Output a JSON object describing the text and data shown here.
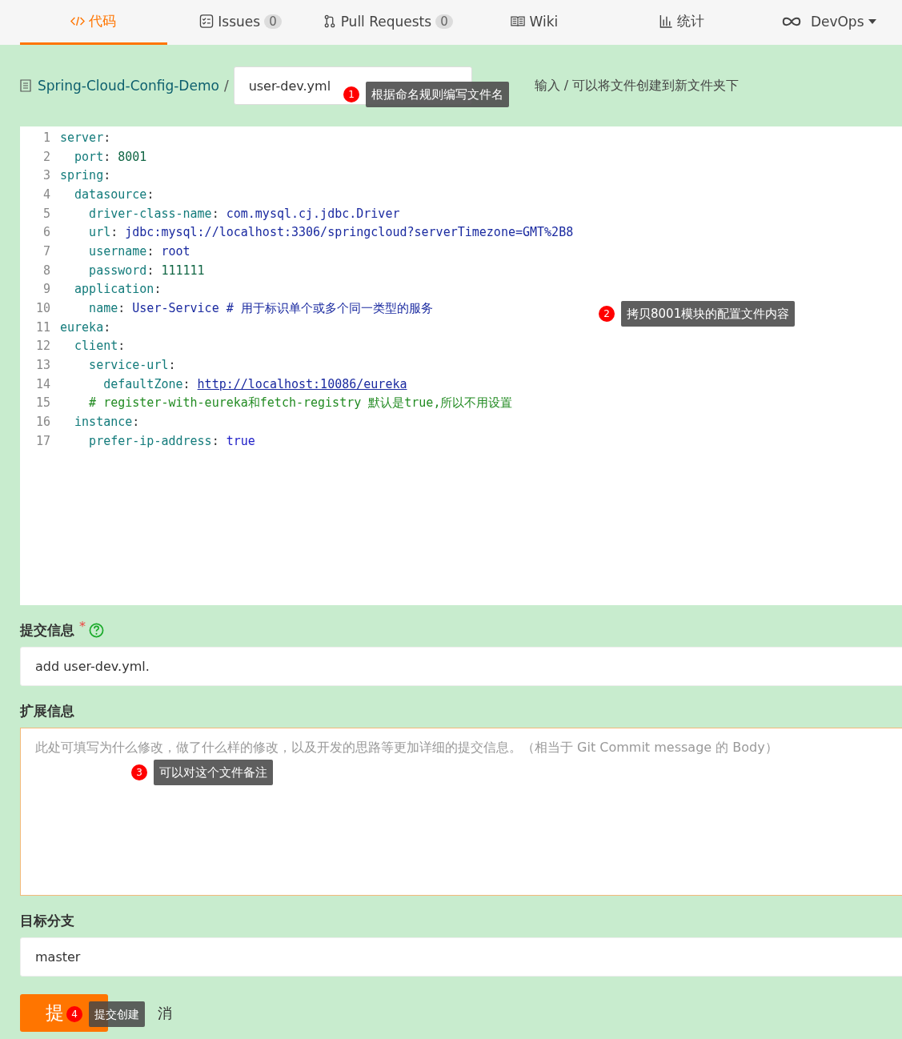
{
  "tabs": [
    {
      "label": "代码",
      "selected": true
    },
    {
      "label": "Issues",
      "count": "0",
      "selected": false
    },
    {
      "label": "Pull Requests",
      "count": "0",
      "selected": false
    },
    {
      "label": "Wiki",
      "selected": false
    },
    {
      "label": "统计",
      "selected": false
    },
    {
      "label": "DevOps",
      "selected": false
    }
  ],
  "breadcrumb": {
    "repo": "Spring-Cloud-Config-Demo",
    "separator": "/",
    "filename": "user-dev.yml",
    "hint": "输入 / 可以将文件创建到新文件夹下"
  },
  "editor": {
    "lines": [
      {
        "number": "1",
        "segments": [
          {
            "kind": "key",
            "text": "server"
          },
          {
            "kind": "punct",
            "text": ":"
          }
        ]
      },
      {
        "number": "2",
        "segments": [
          {
            "kind": "key",
            "text": "  port"
          },
          {
            "kind": "punct",
            "text": ": "
          },
          {
            "kind": "number",
            "text": "8001"
          }
        ]
      },
      {
        "number": "3",
        "segments": [
          {
            "kind": "key",
            "text": "spring"
          },
          {
            "kind": "punct",
            "text": ":"
          }
        ]
      },
      {
        "number": "4",
        "segments": [
          {
            "kind": "key",
            "text": "  datasource"
          },
          {
            "kind": "punct",
            "text": ":"
          }
        ]
      },
      {
        "number": "5",
        "segments": [
          {
            "kind": "key",
            "text": "    driver-class-name"
          },
          {
            "kind": "punct",
            "text": ": "
          },
          {
            "kind": "string",
            "text": "com.mysql.cj.jdbc.Driver"
          }
        ]
      },
      {
        "number": "6",
        "segments": [
          {
            "kind": "key",
            "text": "    url"
          },
          {
            "kind": "punct",
            "text": ": "
          },
          {
            "kind": "string",
            "text": "jdbc:mysql://localhost:3306/springcloud?serverTimezone=GMT%2B8"
          }
        ]
      },
      {
        "number": "7",
        "segments": [
          {
            "kind": "key",
            "text": "    username"
          },
          {
            "kind": "punct",
            "text": ": "
          },
          {
            "kind": "string",
            "text": "root"
          }
        ]
      },
      {
        "number": "8",
        "segments": [
          {
            "kind": "key",
            "text": "    password"
          },
          {
            "kind": "punct",
            "text": ": "
          },
          {
            "kind": "number",
            "text": "111111"
          }
        ]
      },
      {
        "number": "9",
        "segments": [
          {
            "kind": "key",
            "text": "  application"
          },
          {
            "kind": "punct",
            "text": ":"
          }
        ]
      },
      {
        "number": "10",
        "segments": [
          {
            "kind": "key",
            "text": "    name"
          },
          {
            "kind": "punct",
            "text": ": "
          },
          {
            "kind": "string",
            "text": "User-Service # 用于标识单个或多个同一类型的服务"
          }
        ]
      },
      {
        "number": "11",
        "segments": [
          {
            "kind": "key",
            "text": "eureka"
          },
          {
            "kind": "punct",
            "text": ":"
          }
        ]
      },
      {
        "number": "12",
        "segments": [
          {
            "kind": "key",
            "text": "  client"
          },
          {
            "kind": "punct",
            "text": ":"
          }
        ]
      },
      {
        "number": "13",
        "segments": [
          {
            "kind": "key",
            "text": "    service-url"
          },
          {
            "kind": "punct",
            "text": ":"
          }
        ]
      },
      {
        "number": "14",
        "segments": [
          {
            "kind": "key",
            "text": "      defaultZone"
          },
          {
            "kind": "punct",
            "text": ": "
          },
          {
            "kind": "link",
            "text": "http://localhost:10086/eureka"
          }
        ]
      },
      {
        "number": "15",
        "segments": [
          {
            "kind": "comment",
            "text": "    # register-with-eureka和fetch-registry 默认是true,所以不用设置"
          }
        ]
      },
      {
        "number": "16",
        "segments": [
          {
            "kind": "key",
            "text": "  instance"
          },
          {
            "kind": "punct",
            "text": ":"
          }
        ]
      },
      {
        "number": "17",
        "segments": [
          {
            "kind": "key",
            "text": "    prefer-ip-address"
          },
          {
            "kind": "punct",
            "text": ": "
          },
          {
            "kind": "bool",
            "text": "true"
          }
        ]
      }
    ]
  },
  "commit_message": {
    "label": "提交信息",
    "required_mark": "*",
    "value": "add user-dev.yml."
  },
  "extended_info": {
    "label": "扩展信息",
    "placeholder": "此处可填写为什么修改，做了什么样的修改，以及开发的思路等更加详细的提交信息。（相当于 Git Commit message 的 Body）"
  },
  "target_branch": {
    "label": "目标分支",
    "value": "master"
  },
  "actions": {
    "submit": "提",
    "cancel": "消"
  },
  "annotations": [
    {
      "number": "1",
      "text": "根据命名规则编写文件名"
    },
    {
      "number": "2",
      "text": "拷贝8001模块的配置文件内容"
    },
    {
      "number": "3",
      "text": "可以对这个文件备注"
    },
    {
      "number": "4",
      "text": "提交创建"
    }
  ]
}
